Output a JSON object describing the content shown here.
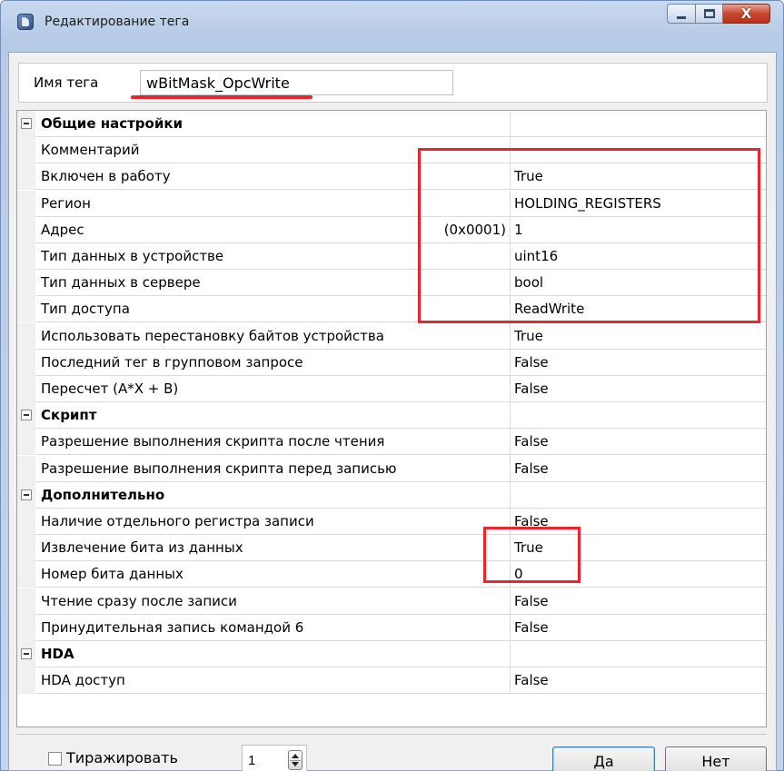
{
  "window": {
    "title": "Редактирование тега",
    "buttons": {
      "minimize": "—",
      "maximize": "☐",
      "close": "X"
    }
  },
  "tag_name": {
    "label": "Имя тега",
    "value": "wBitMask_OpcWrite"
  },
  "grid": {
    "sections": [
      {
        "title": "Общие настройки",
        "rows": [
          {
            "name": "Комментарий",
            "value": ""
          },
          {
            "name": "Включен в работу",
            "value": "True"
          },
          {
            "name": "Регион",
            "value": "HOLDING_REGISTERS"
          },
          {
            "name": "Адрес",
            "prefix": "(0x0001)",
            "value": "1"
          },
          {
            "name": "Тип данных в устройстве",
            "value": "uint16"
          },
          {
            "name": "Тип данных в сервере",
            "value": "bool"
          },
          {
            "name": "Тип доступа",
            "value": "ReadWrite"
          },
          {
            "name": "Использовать перестановку байтов устройства",
            "value": "True"
          },
          {
            "name": "Последний тег в групповом запросе",
            "value": "False"
          },
          {
            "name": "Пересчет (A*X + B)",
            "value": "False"
          }
        ]
      },
      {
        "title": "Скрипт",
        "rows": [
          {
            "name": "Разрешение выполнения скрипта после чтения",
            "value": "False"
          },
          {
            "name": "Разрешение выполнения скрипта перед записью",
            "value": "False"
          }
        ]
      },
      {
        "title": "Дополнительно",
        "rows": [
          {
            "name": "Наличие отдельного регистра записи",
            "value": "False"
          },
          {
            "name": "Извлечение бита из данных",
            "value": "True"
          },
          {
            "name": "Номер бита данных",
            "value": "0"
          },
          {
            "name": "Чтение сразу после записи",
            "value": "False"
          },
          {
            "name": "Принудительная запись командой 6",
            "value": "False"
          }
        ]
      },
      {
        "title": "HDA",
        "rows": [
          {
            "name": "HDA доступ",
            "value": "False"
          }
        ]
      }
    ]
  },
  "footer": {
    "replicate_label": "Тиражировать",
    "replicate_checked": false,
    "count_value": "1",
    "ok_label": "Да",
    "cancel_label": "Нет"
  },
  "colors": {
    "highlight": "#e8262e",
    "accent": "#3c7fb1"
  },
  "icons": {
    "app": "tag-editor-icon",
    "collapse": "minus-box-icon"
  }
}
